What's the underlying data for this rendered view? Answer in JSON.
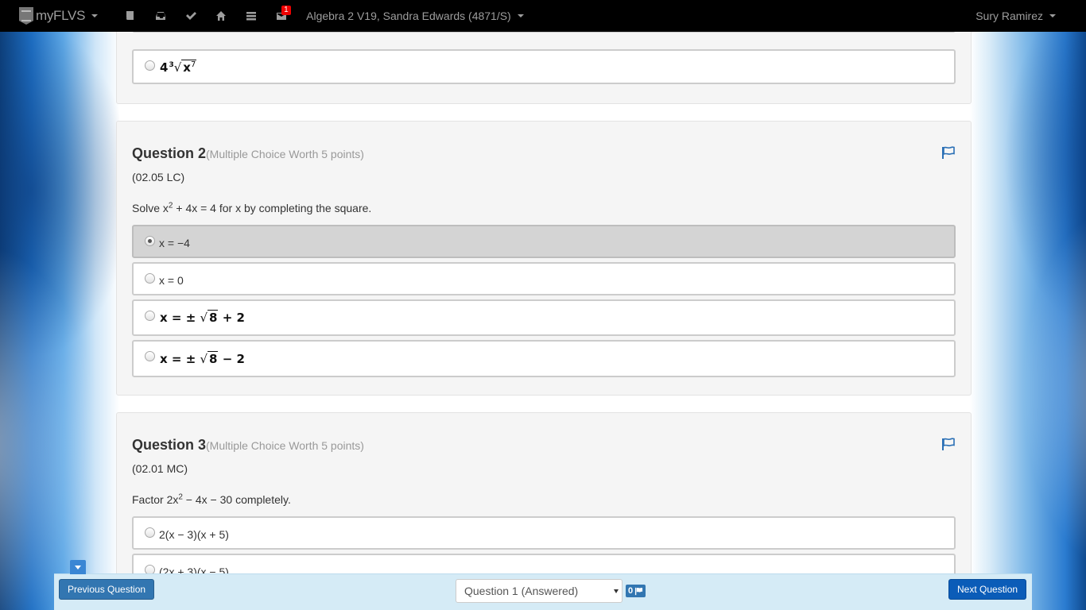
{
  "navbar": {
    "brand": "myFLVS",
    "course_title": "Algebra 2 V19, Sandra Edwards (4871/S)",
    "user_name": "Sury Ramirez",
    "message_badge": "1",
    "icons": [
      "book-icon",
      "inbox-icon",
      "check-icon",
      "home-icon",
      "list-icon",
      "envelope-icon"
    ]
  },
  "question1": {
    "last_option_math": {
      "coef": "4",
      "index": "3",
      "base": "x",
      "exp": "7"
    }
  },
  "question2": {
    "title": "Question 2",
    "subtitle": "(Multiple Choice Worth 5 points)",
    "code": "(02.05 LC)",
    "prompt_pre": "Solve x",
    "prompt_exp": "2",
    "prompt_post": " + 4x = 4 for x by completing the square.",
    "options": [
      {
        "text": "x = −4",
        "selected": true
      },
      {
        "text": "x = 0",
        "selected": false
      },
      {
        "math_pre": "x = ± ",
        "radicand": "8",
        "math_post": " + 2",
        "selected": false
      },
      {
        "math_pre": "x = ± ",
        "radicand": "8",
        "math_post": " − 2",
        "selected": false
      }
    ]
  },
  "question3": {
    "title": "Question 3",
    "subtitle": "(Multiple Choice Worth 5 points)",
    "code": "(02.01 MC)",
    "prompt_pre": "Factor 2x",
    "prompt_exp": "2",
    "prompt_post": " − 4x − 30 completely.",
    "options": [
      {
        "text": "2(x − 3)(x + 5)",
        "selected": false
      },
      {
        "text": "(2x + 3)(x − 5)",
        "selected": false
      }
    ]
  },
  "bottom_bar": {
    "prev_label": "Previous Question",
    "next_label": "Next Question",
    "select_value": "Question 1 (Answered)",
    "flag_count": "0"
  },
  "colors": {
    "navbar_bg": "#000000",
    "button_blue": "#3276b1",
    "selected_option_bg": "#d4d4d4",
    "flag_blue": "#2a6fb5"
  }
}
